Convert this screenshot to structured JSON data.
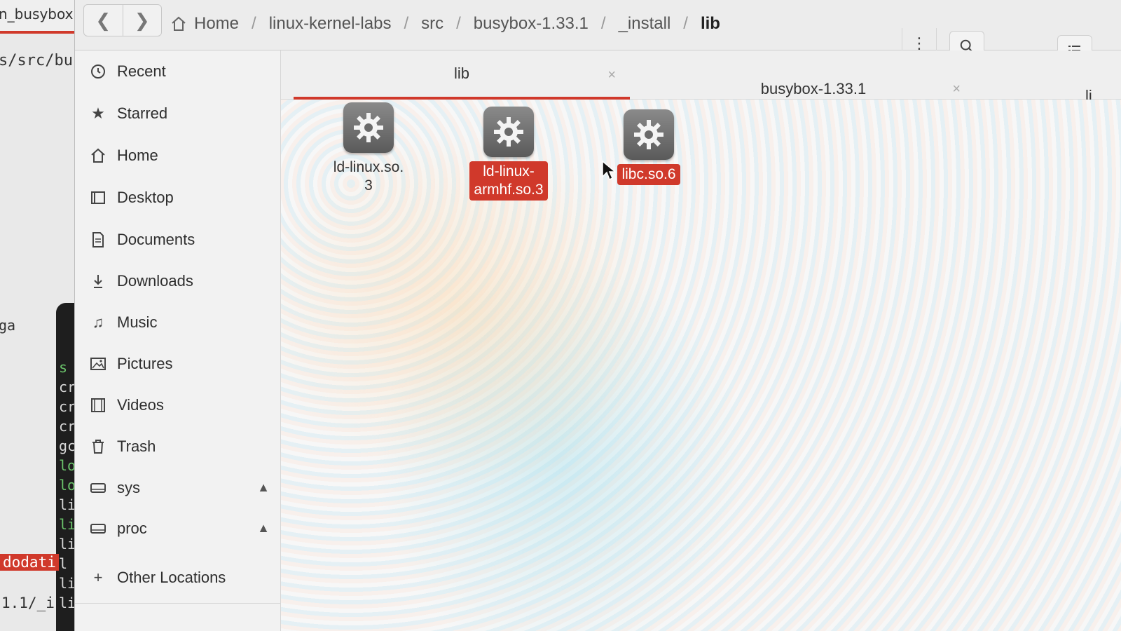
{
  "background_terminal": {
    "tab_title": "n_busybox",
    "path_text": "s/src/bu",
    "side_text": "ga",
    "highlight_text": "dodati",
    "path_text_2": "1.1/_i",
    "term_lines": [
      "s",
      "cr",
      "cr",
      "cr",
      "gc",
      "lo",
      "lo",
      "li",
      "li",
      "li",
      "l",
      "li",
      "li"
    ]
  },
  "headerbar": {
    "back_icon": "chevron-left-icon",
    "forward_icon": "chevron-right-icon",
    "breadcrumbs": [
      "Home",
      "linux-kernel-labs",
      "src",
      "busybox-1.33.1",
      "_install",
      "lib"
    ],
    "separator": "/"
  },
  "sidebar": {
    "items": [
      {
        "label": "Recent",
        "icon": "clock-icon"
      },
      {
        "label": "Starred",
        "icon": "star-icon"
      },
      {
        "label": "Home",
        "icon": "home-icon"
      },
      {
        "label": "Desktop",
        "icon": "desktop-icon"
      },
      {
        "label": "Documents",
        "icon": "document-icon"
      },
      {
        "label": "Downloads",
        "icon": "download-icon"
      },
      {
        "label": "Music",
        "icon": "music-icon"
      },
      {
        "label": "Pictures",
        "icon": "picture-icon"
      },
      {
        "label": "Videos",
        "icon": "video-icon"
      },
      {
        "label": "Trash",
        "icon": "trash-icon"
      },
      {
        "label": "sys",
        "icon": "drive-icon"
      },
      {
        "label": "proc",
        "icon": "drive-icon"
      }
    ],
    "other_locations": "Other Locations"
  },
  "tabs": [
    {
      "label": "lib",
      "active": true
    },
    {
      "label": "busybox-1.33.1",
      "active": false
    }
  ],
  "tab_more": "li",
  "close_glyph": "×",
  "eject_glyph": "▲",
  "files": [
    {
      "name": "ld-linux.so.3",
      "display": "ld-linux.so.\n3",
      "selected": false,
      "icon": "executable-gear-icon"
    },
    {
      "name": "ld-linux-armhf.so.3",
      "display": "ld-linux-\narmhf.so.3",
      "selected": true,
      "icon": "executable-gear-icon"
    },
    {
      "name": "libc.so.6",
      "display": "libc.so.6",
      "selected": true,
      "icon": "executable-gear-icon"
    }
  ],
  "colors": {
    "accent": "#d0392b",
    "sidebar_bg": "#f2f2f2",
    "headerbar_bg": "#ececec"
  }
}
